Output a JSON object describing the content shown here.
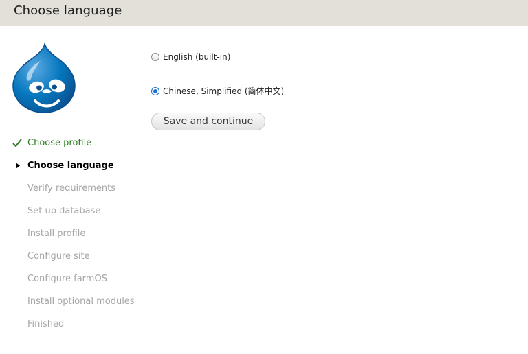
{
  "header": {
    "title": "Choose language"
  },
  "logo": {
    "icon": "drupal-drop-logo",
    "colors": {
      "blue": "#0678be",
      "dark": "#0d4e8c"
    }
  },
  "steps": [
    {
      "label": "Choose profile",
      "state": "done"
    },
    {
      "label": "Choose language",
      "state": "active"
    },
    {
      "label": "Verify requirements",
      "state": "pending"
    },
    {
      "label": "Set up database",
      "state": "pending"
    },
    {
      "label": "Install profile",
      "state": "pending"
    },
    {
      "label": "Configure site",
      "state": "pending"
    },
    {
      "label": "Configure farmOS",
      "state": "pending"
    },
    {
      "label": "Install optional modules",
      "state": "pending"
    },
    {
      "label": "Finished",
      "state": "pending"
    }
  ],
  "language_form": {
    "options": [
      {
        "label": "English (built-in)",
        "checked": false
      },
      {
        "label": "Chinese, Simplified (简体中文)",
        "checked": true
      }
    ],
    "save_label": "Save and continue"
  },
  "colors": {
    "header_bg": "#e2e0d8",
    "done_step": "#2d7a1f",
    "pending_step": "#a6a6a6",
    "radio_accent": "#1a6fd1"
  }
}
